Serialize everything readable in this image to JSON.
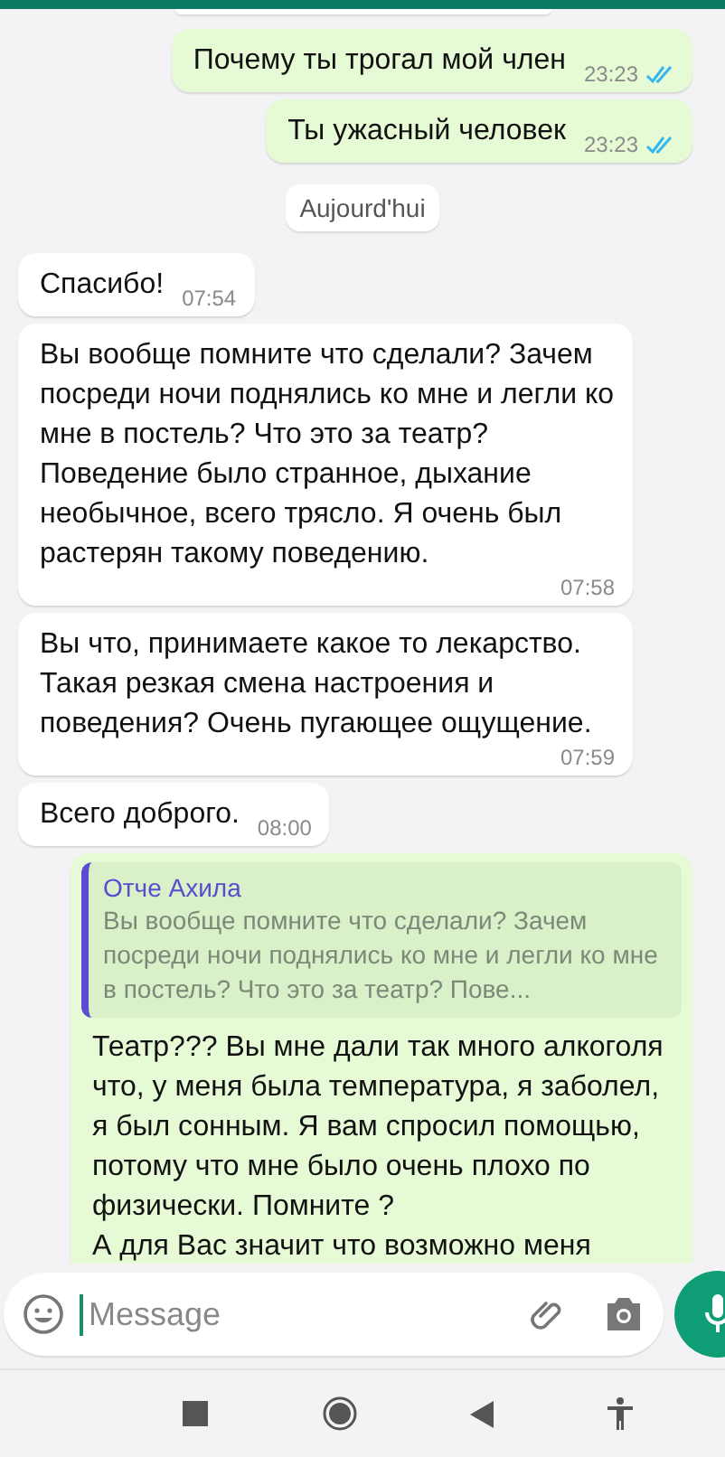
{
  "messages": [
    {
      "kind": "outgoing",
      "text": "Почему ты трогал мой член",
      "time": "23:23",
      "read": true
    },
    {
      "kind": "outgoing",
      "text": "Ты ужасный человек",
      "time": "23:23",
      "read": true
    },
    {
      "kind": "date",
      "text": "Aujourd'hui"
    },
    {
      "kind": "incoming",
      "text": "Спасибо!",
      "time": "07:54"
    },
    {
      "kind": "incoming",
      "text": "Вы вообще помните что сделали? Зачем посреди ночи поднялись ко мне и легли ко мне в постель? Что это за театр? Поведение было странное, дыхание необычное, всего трясло. Я очень был растерян такому поведению.",
      "time": "07:58"
    },
    {
      "kind": "incoming",
      "text": "Вы что, принимаете какое то лекарство. Такая резкая смена настроения и поведения? Очень пугающее ощущение.",
      "time": "07:59"
    },
    {
      "kind": "incoming",
      "text": "Всего доброго.",
      "time": "08:00"
    },
    {
      "kind": "outgoing",
      "quote": {
        "author": "Отче Ахила",
        "text": "Вы вообще помните что сделали? Зачем посреди ночи поднялись ко мне и легли ко мне в постель? Что это за театр? Пове..."
      },
      "text": "Театр??? Вы мне дали так много алкоголя что, у меня была температура, я заболел, я был сонным. Я вам спросил помощью, потому что мне было очень плохо по физически. Помните ?\nА для Вас значит что возможно меня"
    }
  ],
  "composer": {
    "placeholder": "Message"
  }
}
